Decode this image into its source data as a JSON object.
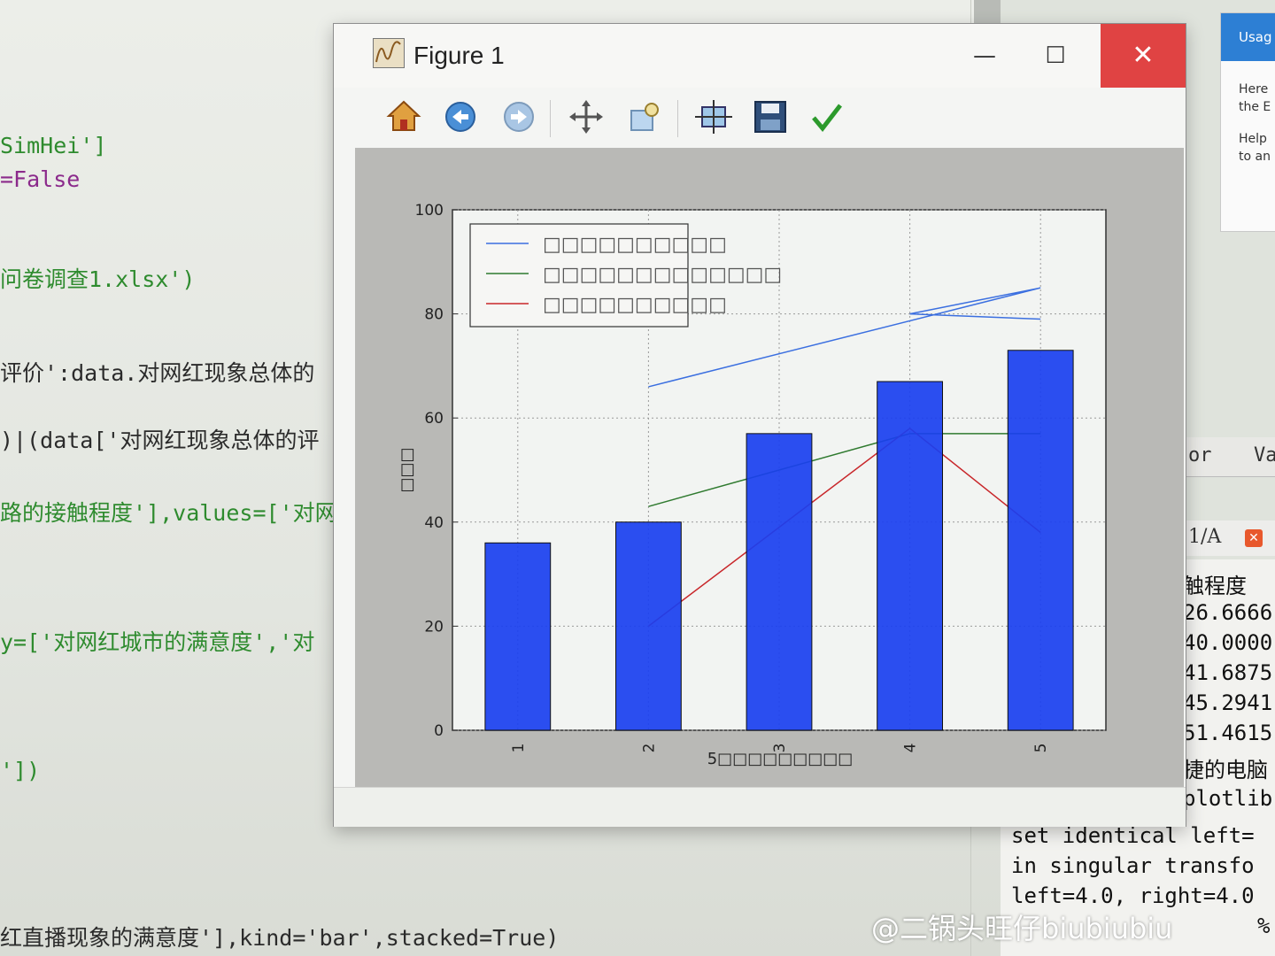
{
  "editor": {
    "lines": [
      {
        "id": "l1",
        "text": "SimHei']"
      },
      {
        "id": "l2",
        "text": "=False"
      },
      {
        "id": "l3",
        "text": "问卷调查1.xlsx')"
      },
      {
        "id": "l4",
        "text": "评价':data.对网红现象总体的"
      },
      {
        "id": "l5",
        "text": ")|(data['对网红现象总体的评"
      },
      {
        "id": "l6",
        "text": "路的接触程度'],values=['对网"
      },
      {
        "id": "l7",
        "text": "y=['对网红城市的满意度','对"
      },
      {
        "id": "l8",
        "text": "'])"
      },
      {
        "id": "l9",
        "text": "红直播现象的满意度'],kind='bar',stacked=True)"
      }
    ]
  },
  "usage_panel": {
    "title": "Usag",
    "lines": [
      "Here",
      "the E",
      "Help",
      "to an"
    ]
  },
  "tabs_strip": {
    "left": "or",
    "right": "Va"
  },
  "console_tab": {
    "label": "1/A",
    "close": "✕"
  },
  "console": {
    "lines": [
      "触程度",
      "26.6666",
      "40.0000",
      "41.6875",
      "45.2941",
      "51.4615",
      "捷的电脑",
      "plotlib",
      "set identical left=",
      "in singular transfo",
      "left=4.0, right=4.0",
      "%"
    ]
  },
  "figure_window": {
    "title": "Figure 1",
    "min_symbol": "—",
    "max_symbol": "☐",
    "close_symbol": "✕",
    "toolbar": [
      {
        "name": "home-icon"
      },
      {
        "name": "back-icon"
      },
      {
        "name": "forward-icon"
      },
      {
        "name": "pan-icon"
      },
      {
        "name": "zoom-icon"
      },
      {
        "name": "subplots-icon"
      },
      {
        "name": "save-icon"
      },
      {
        "name": "edit-check-icon"
      }
    ]
  },
  "chart_data": {
    "type": "bar",
    "categories": [
      "1",
      "2",
      "3",
      "4",
      "5"
    ],
    "values": [
      36,
      40,
      57,
      67,
      73
    ],
    "xlabel": "5□□□□□□□□□",
    "ylabel": "□□□",
    "ylim": [
      0,
      100
    ],
    "yticks": [
      0,
      20,
      40,
      60,
      80,
      100
    ],
    "grid": true,
    "bar_color": "#1a3ff0",
    "legend": {
      "placement": "top-left",
      "entries": [
        {
          "label": "□□□□□□□□□□",
          "color": "#3b6fe0"
        },
        {
          "label": "□□□□□□□□□□□□□",
          "color": "#2f7a2f"
        },
        {
          "label": "□□□□□□□□□□",
          "color": "#c8262a"
        }
      ]
    },
    "line_series": [
      {
        "color": "#3b6fe0",
        "x": [
          2,
          5,
          4,
          5
        ],
        "y": [
          66,
          85,
          80,
          79
        ]
      },
      {
        "color": "#2f7a2f",
        "x": [
          2,
          4,
          5
        ],
        "y": [
          43,
          57,
          57
        ]
      },
      {
        "color": "#c8262a",
        "x": [
          2,
          4,
          5
        ],
        "y": [
          20,
          58,
          38
        ]
      }
    ]
  },
  "watermark": "@二锅头旺仔biubiubiu"
}
